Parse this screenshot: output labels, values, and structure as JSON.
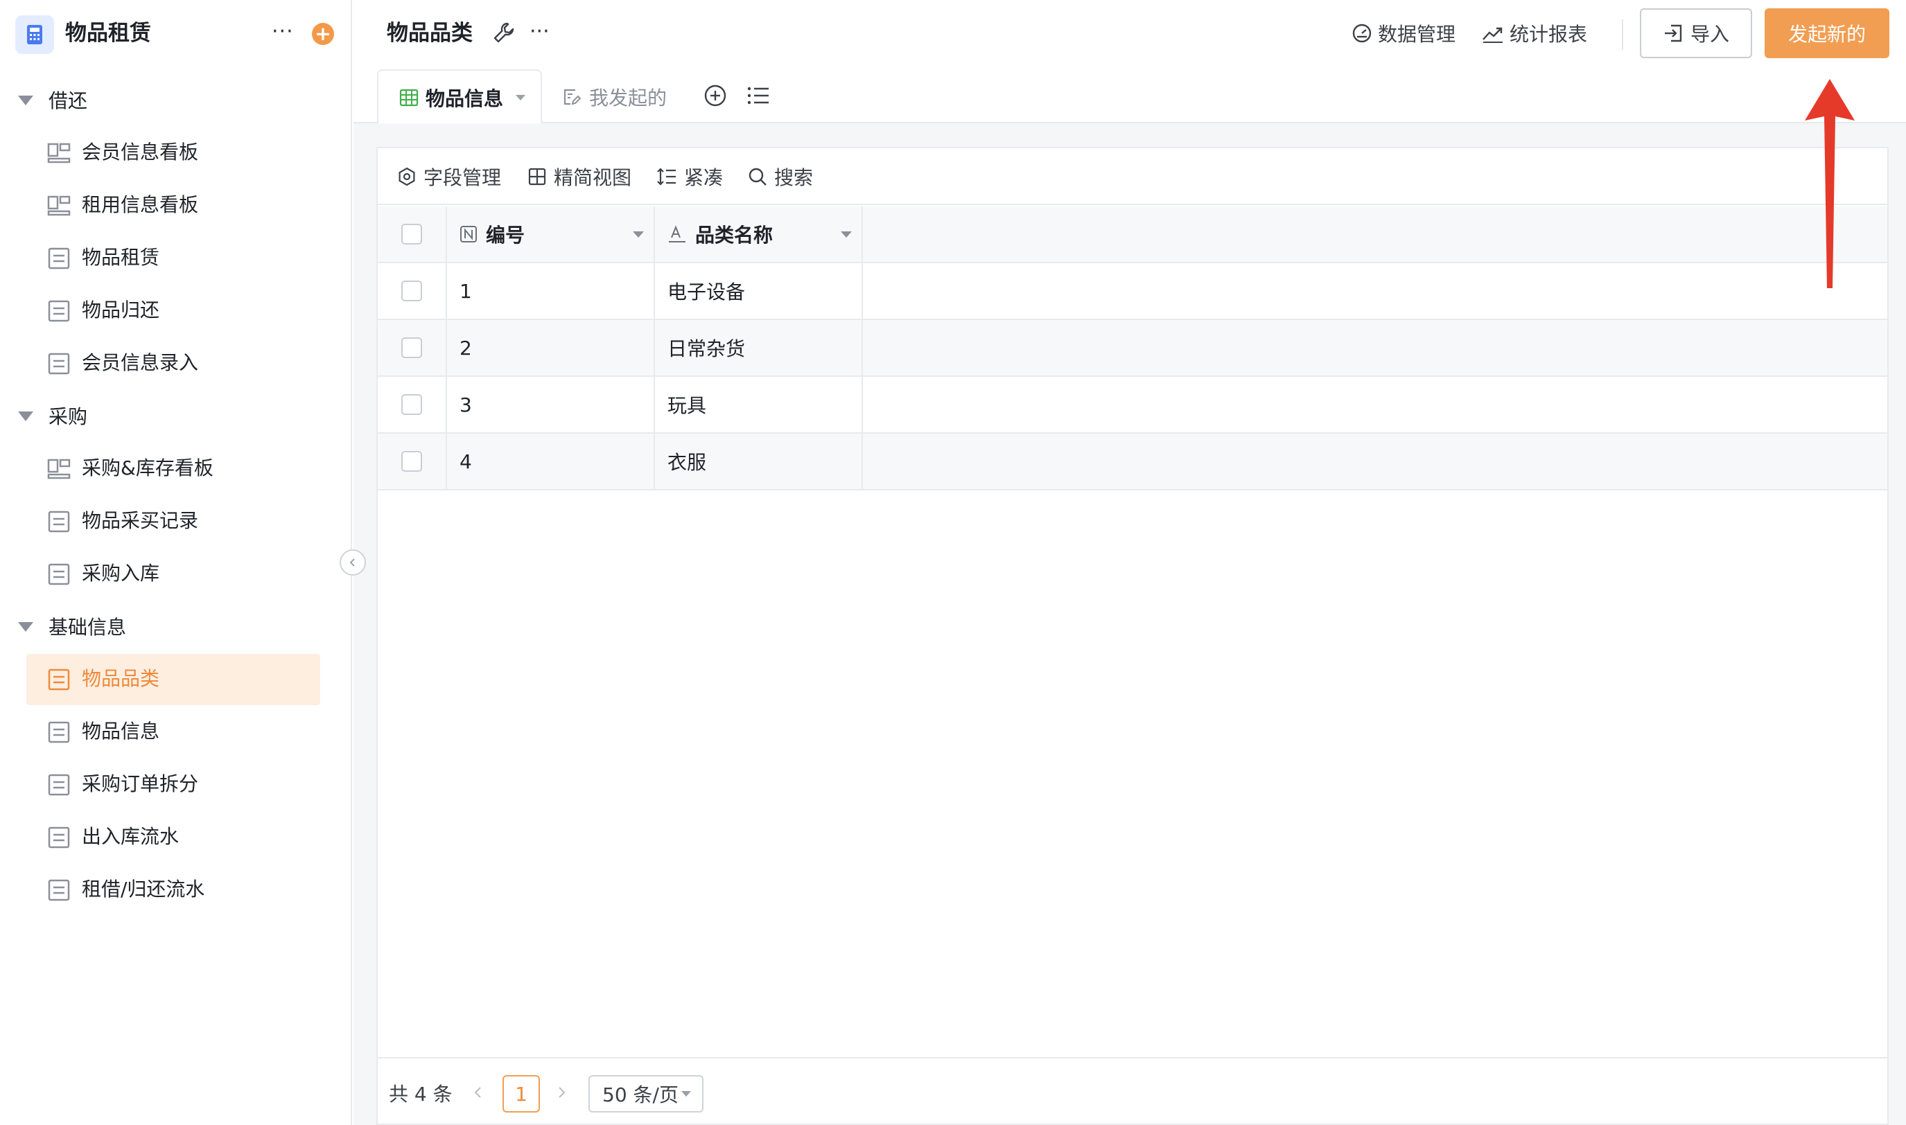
{
  "sidebar": {
    "app_name": "物品租赁",
    "more_label": "···",
    "add_label": "+",
    "groups": [
      {
        "label": "借还",
        "items": [
          {
            "label": "会员信息看板",
            "icon": "board-icon"
          },
          {
            "label": "租用信息看板",
            "icon": "board-icon"
          },
          {
            "label": "物品租赁",
            "icon": "form-icon"
          },
          {
            "label": "物品归还",
            "icon": "form-icon"
          },
          {
            "label": "会员信息录入",
            "icon": "form-icon"
          }
        ]
      },
      {
        "label": "采购",
        "items": [
          {
            "label": "采购&库存看板",
            "icon": "board-icon"
          },
          {
            "label": "物品采买记录",
            "icon": "form-icon"
          },
          {
            "label": "采购入库",
            "icon": "form-icon"
          }
        ]
      },
      {
        "label": "基础信息",
        "items": [
          {
            "label": "物品品类",
            "icon": "form-icon",
            "active": true
          },
          {
            "label": "物品信息",
            "icon": "form-icon"
          },
          {
            "label": "采购订单拆分",
            "icon": "form-icon"
          },
          {
            "label": "出入库流水",
            "icon": "form-icon"
          },
          {
            "label": "租借/归还流水",
            "icon": "form-icon"
          }
        ]
      }
    ]
  },
  "header": {
    "title": "物品品类",
    "more_label": "···",
    "data_manage": "数据管理",
    "stats_report": "统计报表",
    "import_label": "导入",
    "new_label": "发起新的"
  },
  "tabs": {
    "active": "物品信息",
    "mine": "我发起的"
  },
  "toolbar": {
    "fields": "字段管理",
    "compact_view": "精简视图",
    "density": "紧凑",
    "search": "搜索"
  },
  "table": {
    "columns": [
      "编号",
      "品类名称"
    ],
    "rows": [
      {
        "id": "1",
        "name": "电子设备"
      },
      {
        "id": "2",
        "name": "日常杂货"
      },
      {
        "id": "3",
        "name": "玩具"
      },
      {
        "id": "4",
        "name": "衣服"
      }
    ]
  },
  "pager": {
    "total": "共 4 条",
    "current": "1",
    "page_size": "50 条/页"
  },
  "colors": {
    "accent": "#f19e52",
    "active_bg": "#fdeee0",
    "annotation_arrow": "#e53a2a"
  }
}
